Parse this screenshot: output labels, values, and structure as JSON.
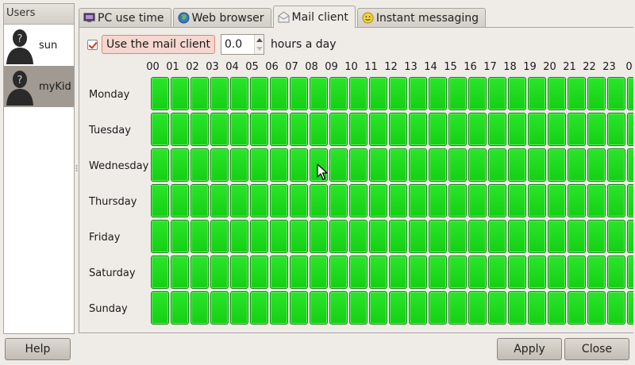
{
  "users": {
    "header": "Users",
    "items": [
      {
        "name": "sun",
        "selected": false
      },
      {
        "name": "myKid",
        "selected": true
      }
    ]
  },
  "tabs": [
    {
      "label": "PC use time",
      "icon": "monitor-icon",
      "active": false
    },
    {
      "label": "Web browser",
      "icon": "globe-icon",
      "active": false
    },
    {
      "label": "Mail client",
      "icon": "mail-icon",
      "active": true
    },
    {
      "label": "Instant messaging",
      "icon": "smiley-icon",
      "active": false
    }
  ],
  "mail": {
    "use_label": "Use the mail client",
    "use_checked": true,
    "hours_value": "0.0",
    "hours_suffix": "hours a day"
  },
  "grid": {
    "hours": [
      "00",
      "01",
      "02",
      "03",
      "04",
      "05",
      "06",
      "07",
      "08",
      "09",
      "10",
      "11",
      "12",
      "13",
      "14",
      "15",
      "16",
      "17",
      "18",
      "19",
      "20",
      "21",
      "22",
      "23",
      "0"
    ],
    "days": [
      "Monday",
      "Tuesday",
      "Wednesday",
      "Thursday",
      "Friday",
      "Saturday",
      "Sunday"
    ],
    "cell_color": "#1fdc1f"
  },
  "buttons": {
    "help": "Help",
    "apply": "Apply",
    "close": "Close"
  }
}
